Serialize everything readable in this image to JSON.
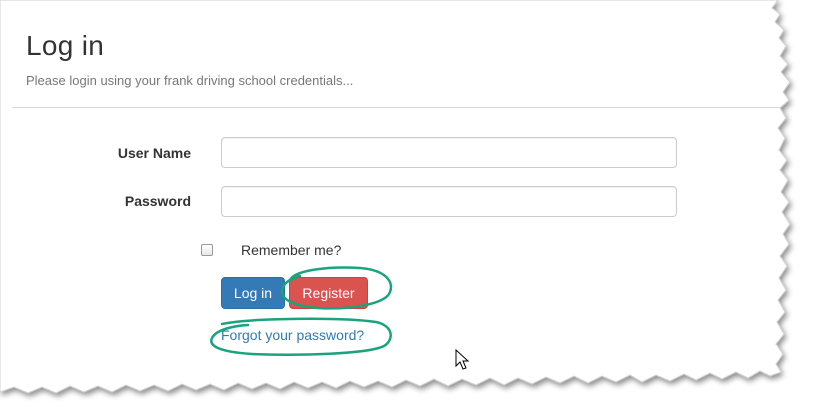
{
  "page": {
    "title": "Log in",
    "subtitle": "Please login using your frank driving school credentials..."
  },
  "form": {
    "username_label": "User Name",
    "username_value": "",
    "password_label": "Password",
    "password_value": "",
    "remember_label": "Remember me?",
    "remember_checked": false,
    "login_button": "Log in",
    "register_button": "Register",
    "forgot_link": "Forgot your password?"
  },
  "colors": {
    "primary": "#337ab7",
    "danger": "#d9534f",
    "annotation": "#1aa37c"
  },
  "icons": {
    "cursor": "mouse-pointer-icon"
  }
}
